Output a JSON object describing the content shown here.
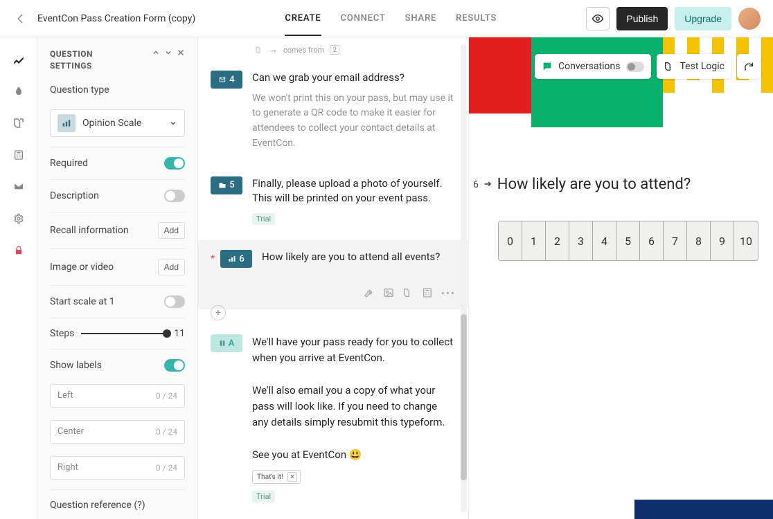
{
  "header": {
    "form_title": "EventCon Pass Creation Form (copy)",
    "tabs": {
      "create": "CREATE",
      "connect": "CONNECT",
      "share": "SHARE",
      "results": "RESULTS"
    },
    "publish": "Publish",
    "upgrade": "Upgrade"
  },
  "settings": {
    "title_line1": "QUESTION",
    "title_line2": "SETTINGS",
    "question_type_label": "Question type",
    "question_type_value": "Opinion Scale",
    "required_label": "Required",
    "description_label": "Description",
    "recall_label": "Recall information",
    "add_btn": "Add",
    "image_label": "Image or video",
    "start_at_1_label": "Start scale at 1",
    "steps_label": "Steps",
    "steps_value": "11",
    "show_labels_label": "Show labels",
    "label_left_ph": "Left",
    "label_center_ph": "Center",
    "label_right_ph": "Right",
    "label_count": "0 / 24",
    "qref_label": "Question reference (?)"
  },
  "logic_chip": {
    "text": "comes from",
    "value": "2"
  },
  "questions": {
    "q4": {
      "num": "4",
      "title": "Can we grab your email address?",
      "desc": "We won't print this on your pass, but may use it to generate a QR code to make it easier for attendees to collect your contact details at EventCon."
    },
    "q5": {
      "num": "5",
      "title": "Finally, please upload a photo of yourself. This will be printed on your event pass.",
      "trial": "Trial"
    },
    "q6": {
      "num": "6",
      "title": "How likely are you to attend all events?"
    },
    "qend": {
      "badge_letter": "A",
      "text_p1": "We'll have your pass ready for you to collect when you arrive at EventCon.",
      "text_p2": "We'll also email you a copy of what your pass will look like. If you need to change any details simply resubmit this typeform.",
      "text_p3": "See you at EventCon 😃",
      "thatsit": "That's it!",
      "trial": "Trial"
    }
  },
  "preview": {
    "conversations_label": "Conversations",
    "test_logic_label": "Test Logic",
    "question_number": "6",
    "question_title": "How likely are you to attend?",
    "scale_values": [
      "0",
      "1",
      "2",
      "3",
      "4",
      "5",
      "6",
      "7",
      "8",
      "9",
      "10"
    ]
  }
}
